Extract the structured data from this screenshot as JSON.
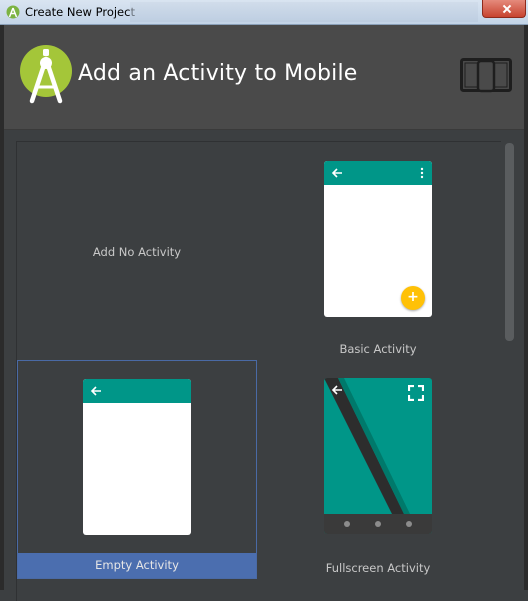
{
  "window": {
    "title": "Create New Project"
  },
  "header": {
    "title": "Add an Activity to Mobile"
  },
  "gallery": {
    "tiles": [
      {
        "label": "Add No Activity",
        "selected": false
      },
      {
        "label": "Basic Activity",
        "selected": false
      },
      {
        "label": "Empty Activity",
        "selected": true
      },
      {
        "label": "Fullscreen Activity",
        "selected": false
      }
    ]
  },
  "colors": {
    "accent_teal": "#009688",
    "fab_yellow": "#ffc107",
    "selection_blue": "#4b6eaf",
    "android_green": "#a4c639"
  },
  "icons": {
    "app": "android-studio-icon",
    "logo": "android-studio-logo",
    "device": "phone-tablet-icon",
    "back": "back-arrow-icon",
    "overflow": "overflow-menu-icon",
    "fab": "plus-icon",
    "fullscreen": "expand-icon"
  }
}
